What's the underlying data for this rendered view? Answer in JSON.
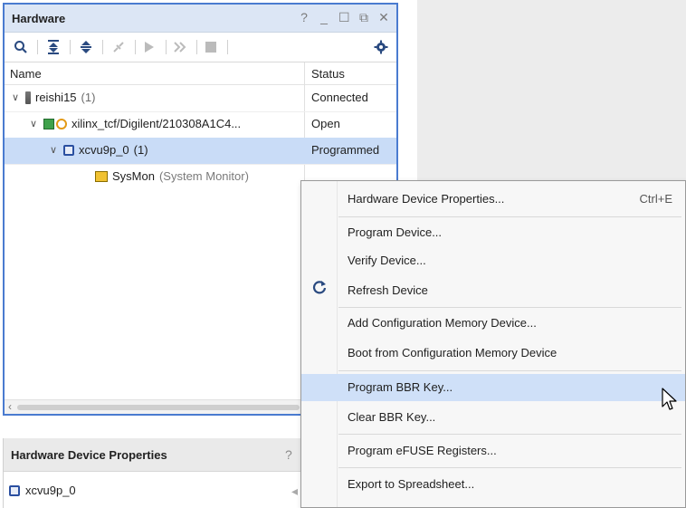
{
  "hardware_panel": {
    "title": "Hardware",
    "window_controls": [
      "?",
      "_",
      "☐",
      "⧉",
      "✕"
    ],
    "toolbar": {
      "icons": [
        "search-icon",
        "collapse-all-icon",
        "expand-all-icon",
        "auto-connect-icon",
        "run-icon",
        "step-icon",
        "stop-icon",
        "gear-icon"
      ]
    },
    "columns": {
      "name": "Name",
      "status": "Status"
    },
    "rows": [
      {
        "name": "reishi15",
        "count": "(1)",
        "status": "Connected",
        "icon": "server-icon"
      },
      {
        "name": "xilinx_tcf/Digilent/210308A1C4...",
        "count": "",
        "status": "Open",
        "icon": "board-icon"
      },
      {
        "name": "xcvu9p_0",
        "count": "(1)",
        "status": "Programmed",
        "icon": "chip-icon",
        "selected": true
      },
      {
        "name": "SysMon",
        "count": "(System Monitor)",
        "status": "",
        "icon": "sysmon-icon"
      }
    ]
  },
  "device_properties_panel": {
    "title": "Hardware Device Properties",
    "help": "?",
    "device": "xcvu9p_0"
  },
  "context_menu": {
    "items": [
      {
        "label": "Hardware Device Properties...",
        "shortcut": "Ctrl+E"
      },
      {
        "label": "Program Device..."
      },
      {
        "label": "Verify Device..."
      },
      {
        "label": "Refresh Device",
        "icon": "refresh-icon"
      },
      {
        "label": "Add Configuration Memory Device..."
      },
      {
        "label": "Boot from Configuration Memory Device"
      },
      {
        "label": "Program BBR Key...",
        "highlighted": true
      },
      {
        "label": "Clear BBR Key..."
      },
      {
        "label": "Program eFUSE Registers..."
      },
      {
        "label": "Export to Spreadsheet..."
      }
    ]
  },
  "colors": {
    "panel_border": "#4a7bd0",
    "header_bg": "#dce6f5",
    "selection": "#c9dcf7",
    "menu_highlight": "#cfe0f8"
  }
}
